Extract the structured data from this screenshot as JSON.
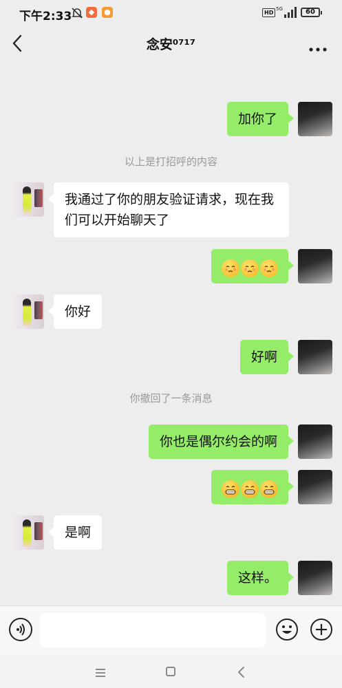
{
  "status_bar": {
    "time": "下午2:33",
    "hd": "HD",
    "network": "5G",
    "battery": "60"
  },
  "header": {
    "title": "念安⁰⁷¹⁷"
  },
  "messages": [
    {
      "side": "me",
      "text": "加你了"
    },
    {
      "type": "system",
      "text": "以上是打招呼的内容"
    },
    {
      "side": "them",
      "text": "我通过了你的朋友验证请求，现在我们可以开始聊天了"
    },
    {
      "side": "me",
      "emoji": "pleading-face-emoji",
      "count": 3
    },
    {
      "side": "them",
      "text": "你好"
    },
    {
      "side": "me",
      "text": "好啊"
    },
    {
      "type": "system",
      "text": "你撤回了一条消息"
    },
    {
      "side": "me",
      "text": "你也是偶尔约会的啊"
    },
    {
      "side": "me",
      "emoji": "grinning-face-emoji",
      "count": 3
    },
    {
      "side": "them",
      "text": "是啊"
    },
    {
      "side": "me",
      "text": "这样。"
    }
  ],
  "input": {
    "value": "",
    "placeholder": ""
  },
  "colors": {
    "my_bubble": "#95ec69",
    "their_bubble": "#ffffff",
    "background": "#ededed",
    "system_text": "#999999"
  },
  "icons": [
    "back-icon",
    "more-icon",
    "voice-icon",
    "emoji-icon",
    "plus-icon",
    "nav-menu-icon",
    "nav-home-icon",
    "nav-back-icon"
  ]
}
